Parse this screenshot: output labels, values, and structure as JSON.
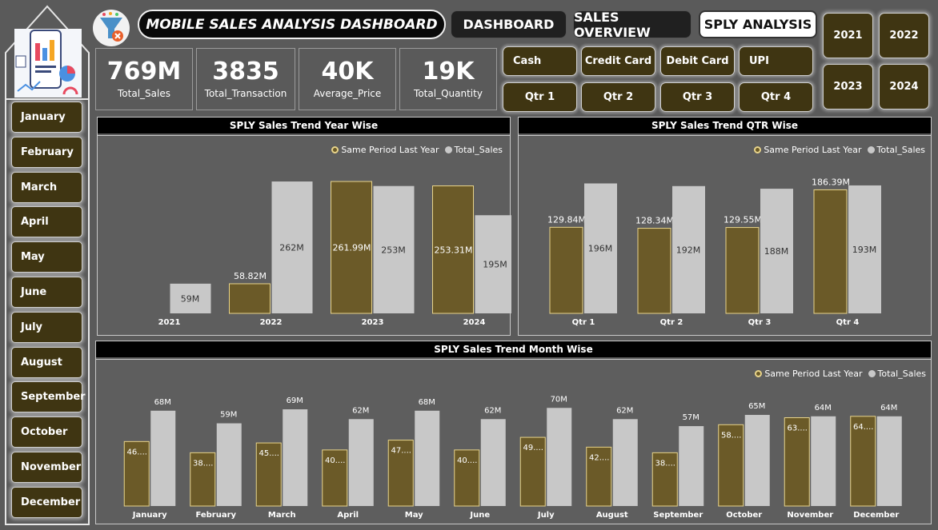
{
  "header": {
    "title": "MOBILE SALES ANALYSIS DASHBOARD",
    "nav": [
      "DASHBOARD",
      "SALES OVERVIEW",
      "SPLY ANALYSIS"
    ]
  },
  "years": [
    "2021",
    "2022",
    "2023",
    "2024"
  ],
  "months": [
    "January",
    "February",
    "March",
    "April",
    "May",
    "June",
    "July",
    "August",
    "September",
    "October",
    "November",
    "December"
  ],
  "kpis": [
    {
      "value": "769M",
      "label": "Total_Sales"
    },
    {
      "value": "3835",
      "label": "Total_Transaction"
    },
    {
      "value": "40K",
      "label": "Average_Price"
    },
    {
      "value": "19K",
      "label": "Total_Quantity"
    }
  ],
  "payment_methods": [
    "Cash",
    "Credit Card",
    "Debit Card",
    "UPI"
  ],
  "quarters": [
    "Qtr 1",
    "Qtr 2",
    "Qtr 3",
    "Qtr 4"
  ],
  "colors": {
    "sply": "#6b5a28",
    "total": "#c8c8c8",
    "button": "#3f3512",
    "background": "#5a5a5a"
  },
  "legend": {
    "sply": "Same Period Last Year",
    "total": "Total_Sales"
  },
  "chart_data": [
    {
      "type": "bar",
      "title": "SPLY Sales Trend Year Wise",
      "categories": [
        "2021",
        "2022",
        "2023",
        "2024"
      ],
      "series": [
        {
          "name": "Same Period Last Year",
          "values": [
            null,
            58.82,
            261.99,
            253.31
          ],
          "labels": [
            "",
            "58.82M",
            "261.99M",
            "253.31M"
          ]
        },
        {
          "name": "Total_Sales",
          "values": [
            59,
            262,
            253,
            195
          ],
          "labels": [
            "59M",
            "262M",
            "253M",
            "195M"
          ]
        }
      ],
      "ymax": 270
    },
    {
      "type": "bar",
      "title": "SPLY Sales Trend QTR Wise",
      "categories": [
        "Qtr 1",
        "Qtr 2",
        "Qtr 3",
        "Qtr 4"
      ],
      "series": [
        {
          "name": "Same Period Last Year",
          "values": [
            129.84,
            128.34,
            129.55,
            186.39
          ],
          "labels": [
            "129.84M",
            "128.34M",
            "129.55M",
            "186.39M"
          ]
        },
        {
          "name": "Total_Sales",
          "values": [
            196,
            192,
            188,
            193
          ],
          "labels": [
            "196M",
            "192M",
            "188M",
            "193M"
          ]
        }
      ],
      "ymax": 205
    },
    {
      "type": "bar",
      "title": "SPLY Sales Trend Month Wise",
      "categories": [
        "January",
        "February",
        "March",
        "April",
        "May",
        "June",
        "July",
        "August",
        "September",
        "October",
        "November",
        "December"
      ],
      "series": [
        {
          "name": "Same Period Last Year",
          "values": [
            46,
            38,
            45,
            40,
            47,
            40,
            49,
            42,
            38,
            58,
            63,
            64
          ],
          "labels": [
            "46....",
            "38....",
            "45....",
            "40....",
            "47....",
            "40....",
            "49....",
            "42....",
            "38....",
            "58....",
            "63....",
            "64...."
          ]
        },
        {
          "name": "Total_Sales",
          "values": [
            68,
            59,
            69,
            62,
            68,
            62,
            70,
            62,
            57,
            65,
            64,
            64
          ],
          "labels": [
            "68M",
            "59M",
            "69M",
            "62M",
            "68M",
            "62M",
            "70M",
            "62M",
            "57M",
            "65M",
            "64M",
            "64M"
          ]
        }
      ],
      "ymax": 73
    }
  ]
}
